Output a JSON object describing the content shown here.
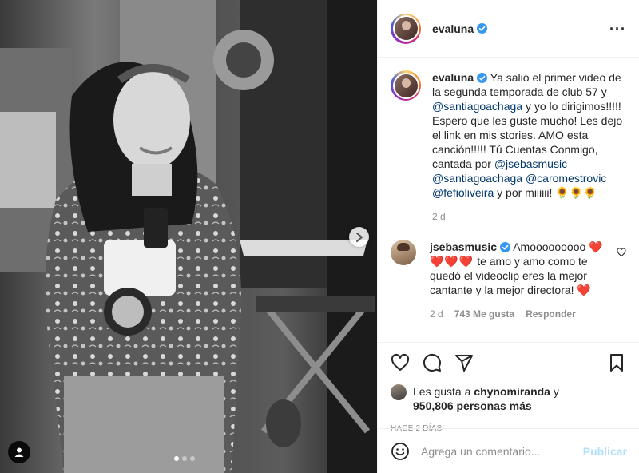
{
  "post": {
    "username": "evaluna",
    "verified": true,
    "more_icon": "more-horizontal-icon"
  },
  "caption": {
    "username": "evaluna",
    "text_1": "Ya salió el primer video de la segunda temporada de club 57 y",
    "mention_1": "@santiagoachaga",
    "text_2": "y yo lo dirigimos!!!!! Espero que les guste mucho! Les dejo el link en mis stories. AMO esta canción!!!!! Tú Cuentas Conmigo, cantada por",
    "mention_2": "@jsebasmusic",
    "mention_3": "@santiagoachaga",
    "mention_4": "@caromestrovic",
    "mention_5": "@fefioliveira",
    "text_3": "y por miiiiii! 🌻🌻🌻",
    "time": "2 d"
  },
  "comment": {
    "username": "jsebasmusic",
    "verified": true,
    "text_1": "Amooooooooo",
    "hearts": "❤️❤️❤️❤️",
    "text_2": "te amo y amo como te quedó el videoclip eres la mejor cantante y la mejor directora! ❤️",
    "time": "2 d",
    "likes": "743 Me gusta",
    "reply": "Responder"
  },
  "likes": {
    "prefix": "Les gusta a",
    "user": "chynomiranda",
    "connector": "y",
    "count": "950,806 personas más"
  },
  "time_ago": "HACE 2 DÍAS",
  "add_comment": {
    "placeholder": "Agrega un comentario...",
    "publish_label": "Publicar"
  },
  "carousel": {
    "slide_count": 3,
    "active_index": 0
  },
  "colors": {
    "link": "#00376b",
    "verified": "#3897f0",
    "heart": "#ed4956",
    "publish_disabled": "#b2dffc",
    "muted": "#8e8e8e"
  }
}
